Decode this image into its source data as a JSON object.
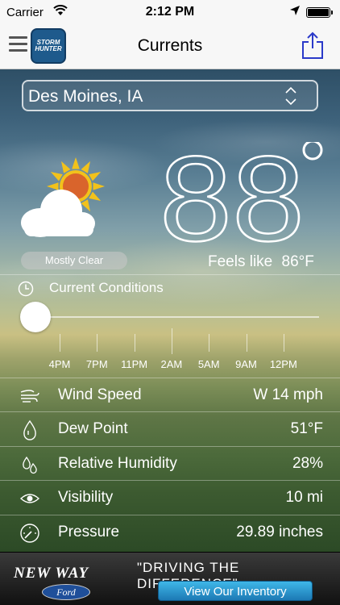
{
  "status_bar": {
    "carrier": "Carrier",
    "time": "2:12 PM",
    "battery_level": 1.0
  },
  "nav": {
    "title": "Currents",
    "logo_text_top": "STORM",
    "logo_text_bottom": "HUNTER"
  },
  "location": {
    "selected": "Des Moines, IA"
  },
  "current": {
    "temperature": "88",
    "degree_symbol": "°",
    "condition": "Mostly Clear",
    "feels_like_label": "Feels like",
    "feels_like_value": "86°F"
  },
  "conditions": {
    "title": "Current Conditions",
    "timeline_labels": [
      "4PM",
      "7PM",
      "11PM",
      "2AM",
      "5AM",
      "9AM",
      "12PM"
    ],
    "slider_position": 0
  },
  "rows": [
    {
      "icon": "wind-icon",
      "label": "Wind Speed",
      "value": "W 14 mph"
    },
    {
      "icon": "dew-drop-icon",
      "label": "Dew Point",
      "value": "51°F"
    },
    {
      "icon": "humidity-drops-icon",
      "label": "Relative Humidity",
      "value": "28%"
    },
    {
      "icon": "eye-icon",
      "label": "Visibility",
      "value": "10 mi"
    },
    {
      "icon": "gauge-icon",
      "label": "Pressure",
      "value": "29.89 inches"
    }
  ],
  "ad": {
    "brand": "NEW WAY",
    "ford": "Ford",
    "slogan": "\"DRIVING THE DIFFERENCE\"",
    "cta": "View Our Inventory"
  },
  "colors": {
    "sun": "#f2c21b",
    "sun_core": "#d9642c",
    "cta": "#2a9ad6"
  }
}
